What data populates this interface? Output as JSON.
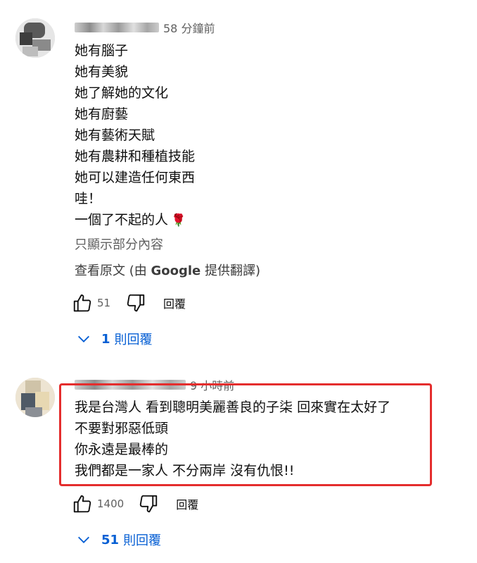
{
  "comments": [
    {
      "time": "58 分鐘前",
      "lines": [
        "她有腦子",
        "她有美貌",
        "她了解她的文化",
        "她有廚藝",
        "她有藝術天賦",
        "她有農耕和種植技能",
        "她可以建造任何東西",
        "哇！",
        "一個了不起的人"
      ],
      "emoji": "🌹",
      "show_less": "只顯示部分內容",
      "translate_prefix": "查看原文 (由 ",
      "translate_brand": "Google",
      "translate_suffix": " 提供翻譯)",
      "likes": "51",
      "reply_label": "回覆",
      "replies_count": "1",
      "replies_label": "則回覆"
    },
    {
      "time": "9 小時前",
      "lines": [
        "我是台灣人 看到聰明美麗善良的子柒 回來實在太好了",
        "不要對邪惡低頭",
        "你永遠是最棒的",
        "我們都是一家人 不分兩岸 沒有仇恨!!"
      ],
      "likes": "1400",
      "reply_label": "回覆",
      "replies_count": "51",
      "replies_label": "則回覆"
    }
  ],
  "colors": {
    "highlight": "#e42d2d",
    "link": "#065fd4",
    "secondary_text": "#606060"
  }
}
